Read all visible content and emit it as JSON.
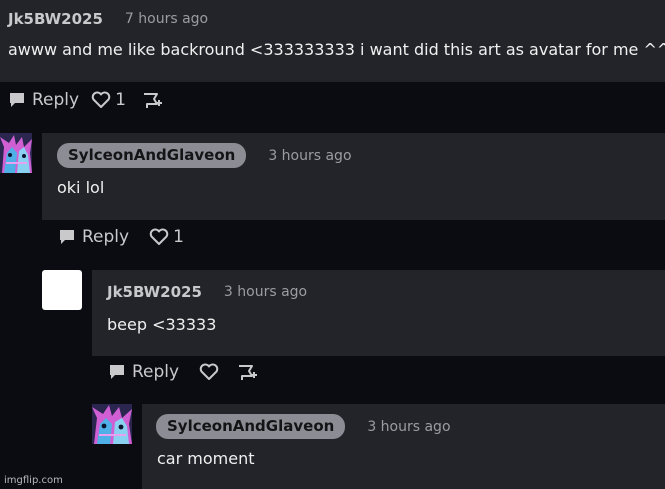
{
  "comments": [
    {
      "username": "Jk5BW2025",
      "time": "7 hours ago",
      "text": "awww and me like backround <333333333 i want did this art as avatar for me ^^",
      "reply_label": "Reply",
      "like_count": "1"
    },
    {
      "username": "SylceonAndGlaveon",
      "time": "3 hours ago",
      "text": "oki lol",
      "reply_label": "Reply",
      "like_count": "1"
    },
    {
      "username": "Jk5BW2025",
      "time": "3 hours ago",
      "text": "beep <33333",
      "reply_label": "Reply"
    },
    {
      "username": "SylceonAndGlaveon",
      "time": "3 hours ago",
      "text": "car moment"
    }
  ],
  "icons": {
    "reply": "speech-bubble-icon",
    "like": "heart-outline-icon",
    "report": "flag-icon"
  },
  "colors": {
    "background": "#0b0c11",
    "bubble": "#232429",
    "pill": "#8c8d94",
    "text": "#f0f0f0",
    "muted": "#9b9ca3"
  },
  "watermark": "imgflip.com"
}
